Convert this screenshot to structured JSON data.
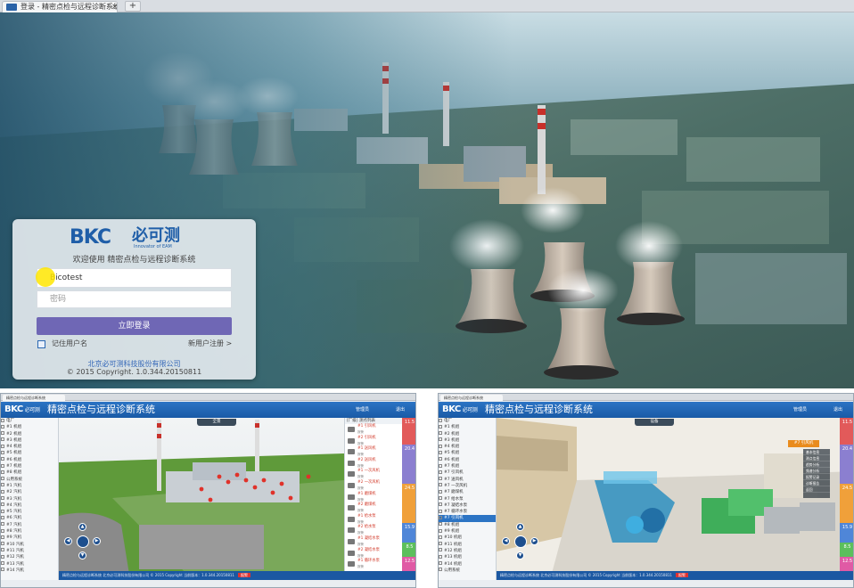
{
  "browser": {
    "tab_title": "登录 - 精密点检与远程诊断系统",
    "tab_close": "×",
    "new_tab": "+"
  },
  "login": {
    "logo_main": "BKC",
    "logo_cn": "必可测",
    "logo_sub": "Innovator of EAM",
    "welcome": "欢迎使用 精密点检与远程诊断系统",
    "username_value": "Bicotest",
    "password_placeholder": "密码",
    "login_button": "立即登录",
    "remember": "记住用户名",
    "register": "新用户注册 >",
    "company": "北京必可测科技股份有限公司",
    "copyright": "© 2015 Copyright. 1.0.344.20150811"
  },
  "app_left": {
    "logo": "BKC",
    "logo_small": "必可测",
    "title": "精密点检与远程诊断系统",
    "user_a": "管理员",
    "user_b": "退出",
    "scene_tab": "全景",
    "tree": [
      "电厂",
      "#1 机组",
      "#2 机组",
      "#3 机组",
      "#4 机组",
      "#5 机组",
      "#6 机组",
      "#7 机组",
      "#8 机组",
      "公用系统",
      "#1 汽机",
      "#2 汽机",
      "#3 汽机",
      "#4 汽机",
      "#5 汽机",
      "#6 汽机",
      "#7 汽机",
      "#8 汽机",
      "#9 汽机",
      "#10 汽机",
      "#11 汽机",
      "#12 汽机",
      "#13 汽机",
      "#14 汽机"
    ],
    "list_head": "[厂级] 测点列表",
    "list": [
      {
        "name": "#1 引风机",
        "sub": "报警"
      },
      {
        "name": "#2 引风机",
        "sub": "报警"
      },
      {
        "name": "#1 送风机",
        "sub": "报警"
      },
      {
        "name": "#2 送风机",
        "sub": "报警"
      },
      {
        "name": "#1 一次风机",
        "sub": "报警"
      },
      {
        "name": "#2 一次风机",
        "sub": "报警"
      },
      {
        "name": "#1 磨煤机",
        "sub": "报警"
      },
      {
        "name": "#2 磨煤机",
        "sub": "报警"
      },
      {
        "name": "#1 给水泵",
        "sub": "报警"
      },
      {
        "name": "#2 给水泵",
        "sub": "报警"
      },
      {
        "name": "#1 凝结水泵",
        "sub": "报警"
      },
      {
        "name": "#2 凝结水泵",
        "sub": "报警"
      },
      {
        "name": "#1 循环水泵",
        "sub": "报警"
      }
    ],
    "bars": [
      "11.5",
      "20.4",
      "24.5",
      "15.9",
      "8.5",
      "12.5"
    ],
    "status": "精密点检与远程诊断系统  北京必可测科技股份有限公司  © 2015 Copyright  当前版本：1.0.344.20150811",
    "status_red": "报警"
  },
  "app_right": {
    "logo": "BKC",
    "logo_small": "必可测",
    "title": "精密点检与远程诊断系统",
    "user_a": "管理员",
    "user_b": "退出",
    "scene_tab": "设备",
    "selected_tag": "#7 引风机",
    "menu": [
      "基本信息",
      "测点信息",
      "趋势分析",
      "频谱分析",
      "报警记录",
      "诊断报告",
      "返回"
    ],
    "tree": [
      "电厂",
      "#1 机组",
      "#2 机组",
      "#3 机组",
      "#4 机组",
      "#5 机组",
      "#6 机组",
      "#7 机组",
      "#7 引风机",
      "#7 送风机",
      "#7 一次风机",
      "#7 磨煤机",
      "#7 给水泵",
      "#7 凝结水泵",
      "#7 循环水泵",
      "#7 引风机",
      "#8 机组",
      "#9 机组",
      "#10 机组",
      "#11 机组",
      "#12 机组",
      "#13 机组",
      "#14 机组",
      "公用系统"
    ],
    "selected_index": 15,
    "bars": [
      "11.5",
      "20.4",
      "24.5",
      "15.9",
      "8.5",
      "12.5"
    ],
    "status": "精密点检与远程诊断系统  北京必可测科技股份有限公司  © 2015 Copyright  当前版本：1.0.344.20150811",
    "status_red": "报警"
  },
  "colors": {
    "brand_blue": "#1f5ea8",
    "login_button": "#6f67b5",
    "header_blue": "#2c74c4",
    "bar_red": "#e25a5a",
    "bar_purple": "#8b7fd0",
    "bar_orange": "#f0a03a",
    "bar_blue": "#4f86d8",
    "bar_green": "#5cbf5c",
    "bar_pink": "#e05aa5"
  }
}
